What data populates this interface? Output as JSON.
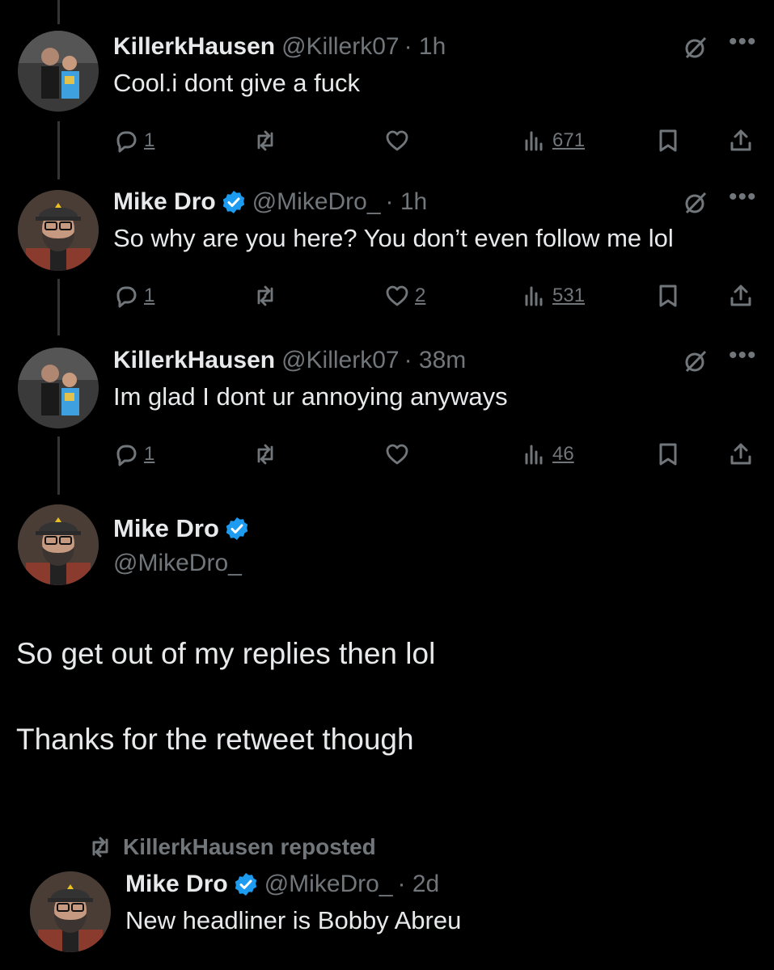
{
  "replies": [
    {
      "name": "KillerkHausen",
      "handle": "@Killerk07",
      "time": "· 1h",
      "text": "Cool.i dont give a fuck",
      "reply_count": "1",
      "like_count": "",
      "views": "671",
      "verified": false
    },
    {
      "name": "Mike Dro",
      "handle": "@MikeDro_",
      "time": "· 1h",
      "text": "So why are you here? You don’t even follow me lol",
      "reply_count": "1",
      "like_count": "2",
      "views": "531",
      "verified": true
    },
    {
      "name": "KillerkHausen",
      "handle": "@Killerk07",
      "time": "· 38m",
      "text": "Im glad I dont ur annoying anyways",
      "reply_count": "1",
      "like_count": "",
      "views": "46",
      "verified": false
    }
  ],
  "main_post": {
    "name": "Mike Dro",
    "handle": "@MikeDro_",
    "line1": "So get out of my replies then lol",
    "line2": "Thanks for the retweet though"
  },
  "reposted": {
    "label": "KillerkHausen reposted",
    "name": "Mike Dro",
    "handle": "@MikeDro_",
    "time": "· 2d",
    "text": "New headliner is Bobby Abreu"
  },
  "colors": {
    "background": "#000000",
    "text": "#e7e9ea",
    "muted": "#71767b",
    "verified": "#1d9bf0"
  }
}
